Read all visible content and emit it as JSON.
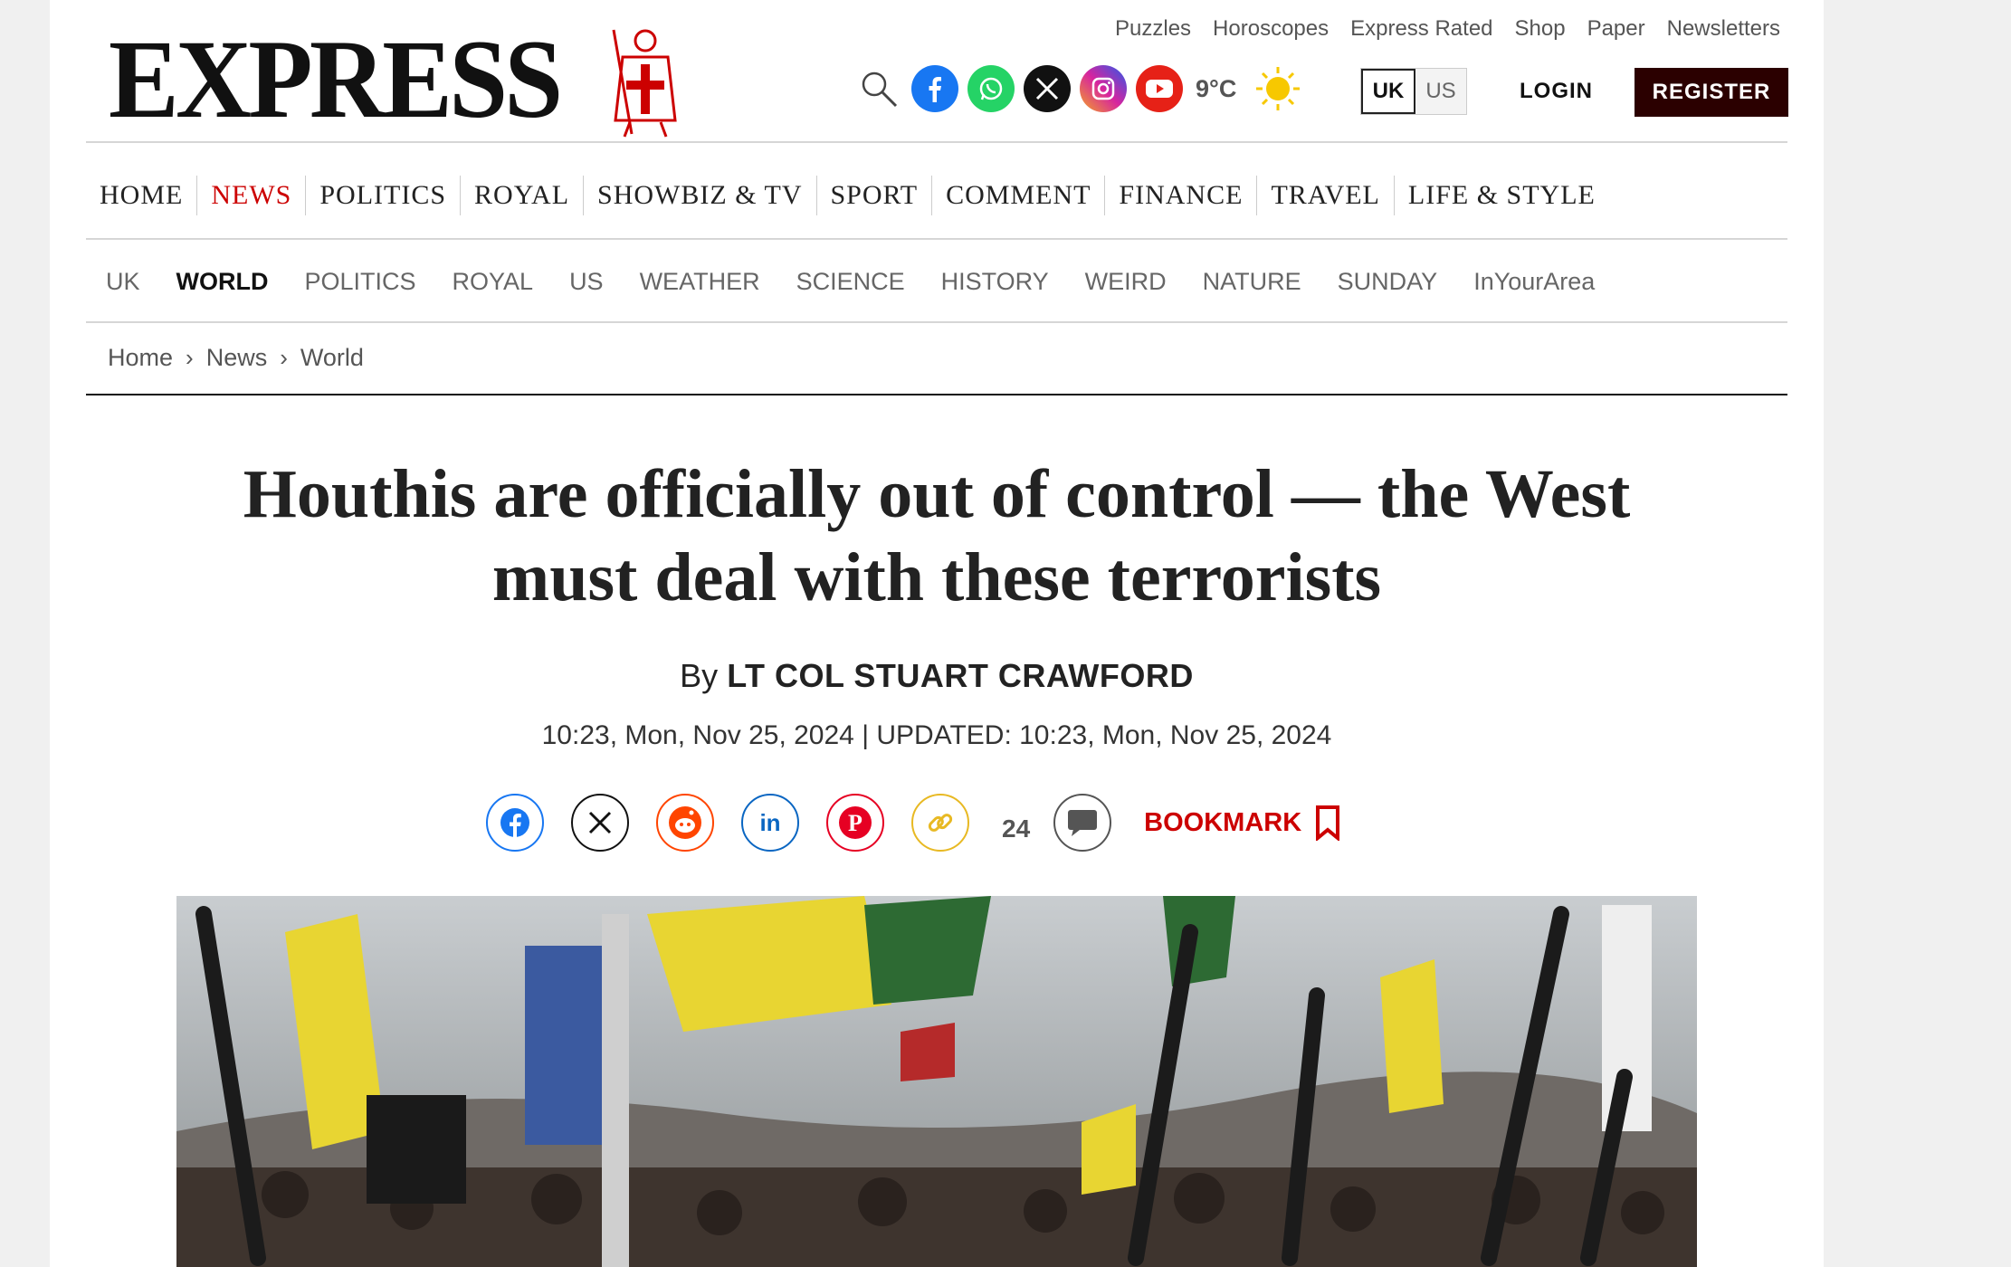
{
  "brand": {
    "name": "EXPRESS"
  },
  "top_links": [
    "Puzzles",
    "Horoscopes",
    "Express Rated",
    "Shop",
    "Paper",
    "Newsletters"
  ],
  "weather": {
    "temp": "9°C",
    "icon": "sun-icon"
  },
  "social_icons": [
    "search-icon",
    "facebook-icon",
    "whatsapp-icon",
    "x-icon",
    "instagram-icon",
    "youtube-icon"
  ],
  "edition": {
    "uk": "UK",
    "us": "US",
    "selected": "UK"
  },
  "auth": {
    "login": "LOGIN",
    "register": "REGISTER"
  },
  "main_nav": [
    "HOME",
    "NEWS",
    "POLITICS",
    "ROYAL",
    "SHOWBIZ & TV",
    "SPORT",
    "COMMENT",
    "FINANCE",
    "TRAVEL",
    "LIFE & STYLE"
  ],
  "main_nav_active": "NEWS",
  "sub_nav": [
    "UK",
    "WORLD",
    "POLITICS",
    "ROYAL",
    "US",
    "WEATHER",
    "SCIENCE",
    "HISTORY",
    "WEIRD",
    "NATURE",
    "SUNDAY",
    "InYourArea"
  ],
  "sub_nav_active": "WORLD",
  "breadcrumb": [
    "Home",
    "News",
    "World"
  ],
  "article": {
    "headline_line1": "Houthis are officially out of control — the West",
    "headline_line2": "must deal with these terrorists",
    "by_prefix": "By",
    "author": "LT COL STUART CRAWFORD",
    "dates": "10:23, Mon, Nov 25, 2024 | UPDATED: 10:23, Mon, Nov 25, 2024",
    "comment_count": "24",
    "bookmark": "BOOKMARK"
  },
  "share_icons": [
    "facebook-icon",
    "x-icon",
    "reddit-icon",
    "linkedin-icon",
    "pinterest-icon",
    "link-icon",
    "comment-icon",
    "bookmark-icon"
  ],
  "colors": {
    "accent_red": "#cc0000",
    "register_bg": "#2b0000"
  }
}
